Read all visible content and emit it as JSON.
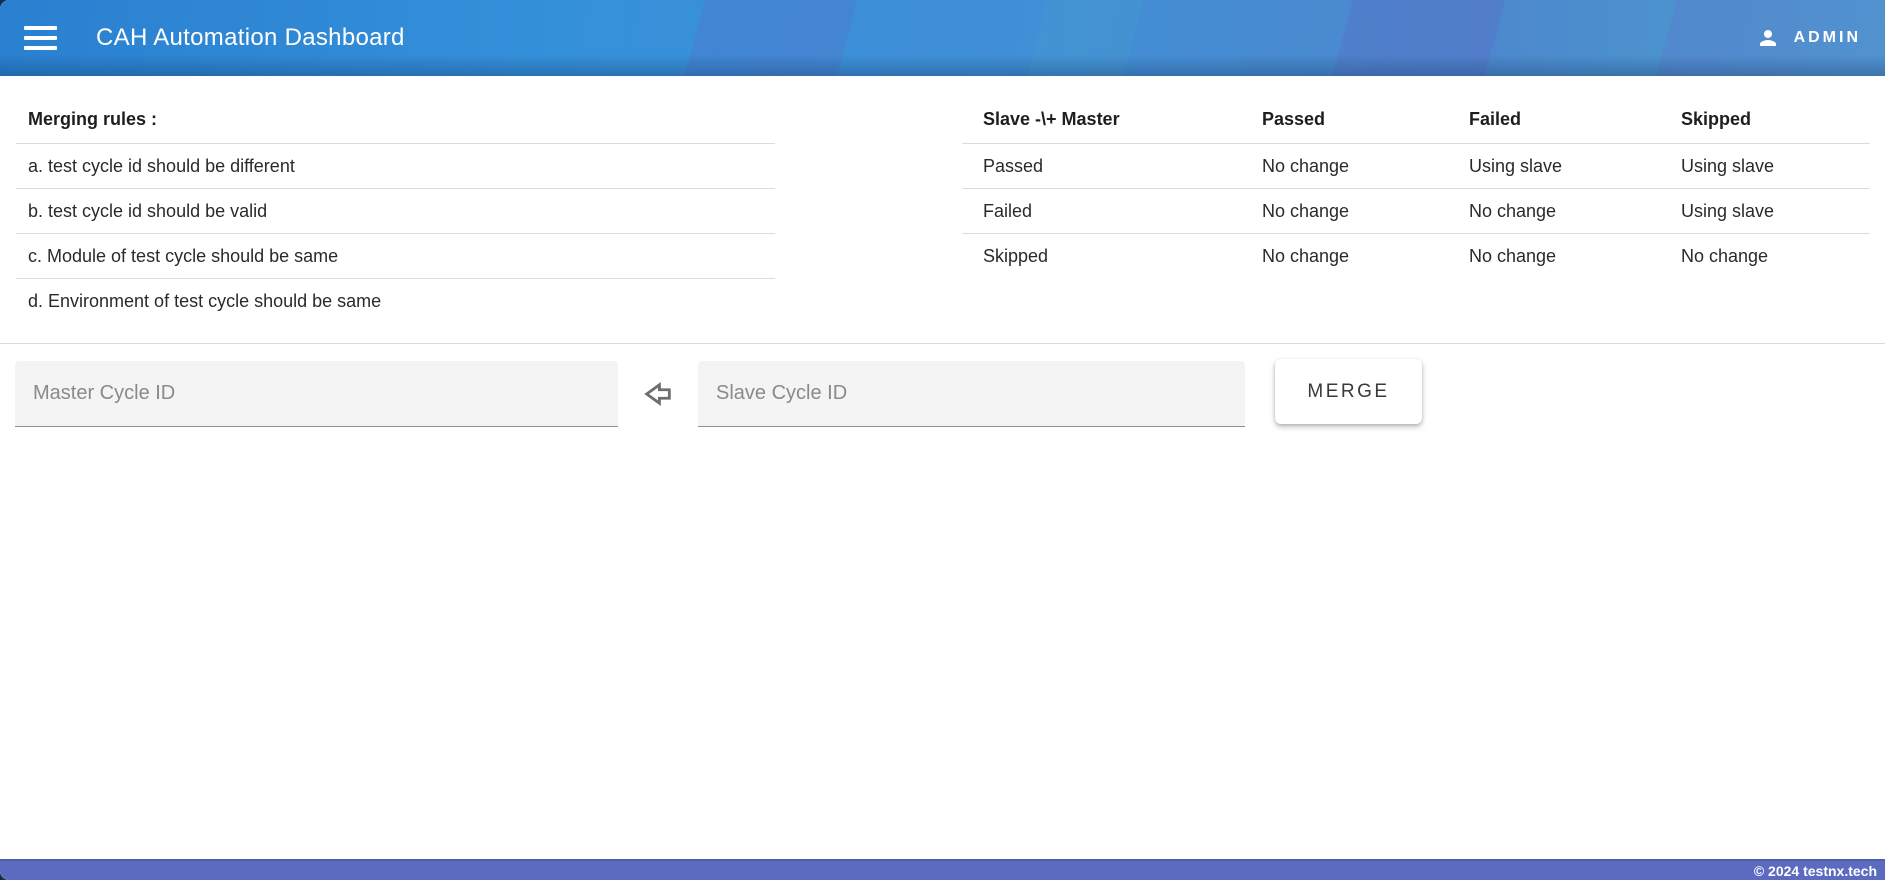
{
  "header": {
    "title": "CAH Automation Dashboard",
    "user_label": "ADMIN",
    "icons": {
      "menu": "hamburger-3-bars",
      "user": "person-silhouette"
    }
  },
  "rules": {
    "title": "Merging rules :",
    "items": [
      "a. test cycle id should be different",
      "b. test cycle id should be valid",
      "c. Module of test cycle should be same",
      "d. Environment of test cycle should be same"
    ]
  },
  "merge_table": {
    "columns": [
      "Slave -\\+ Master",
      "Passed",
      "Failed",
      "Skipped"
    ],
    "rows": [
      [
        "Passed",
        "No change",
        "Using slave",
        "Using slave"
      ],
      [
        "Failed",
        "No change",
        "No change",
        "Using slave"
      ],
      [
        "Skipped",
        "No change",
        "No change",
        "No change"
      ]
    ]
  },
  "merge_form": {
    "master_placeholder": "Master Cycle ID",
    "slave_placeholder": "Slave Cycle ID",
    "merge_button_label": "MERGE",
    "direction_icon": "leftwards-white-arrow"
  },
  "footer": {
    "copyright": "© 2024 testnx.tech"
  },
  "colors": {
    "header_blue": "#3590da",
    "footer_indigo": "#5c6bc0",
    "divider": "#dcdcdc",
    "field_bg": "#f4f4f4",
    "text_dark": "#2a2a2a"
  }
}
